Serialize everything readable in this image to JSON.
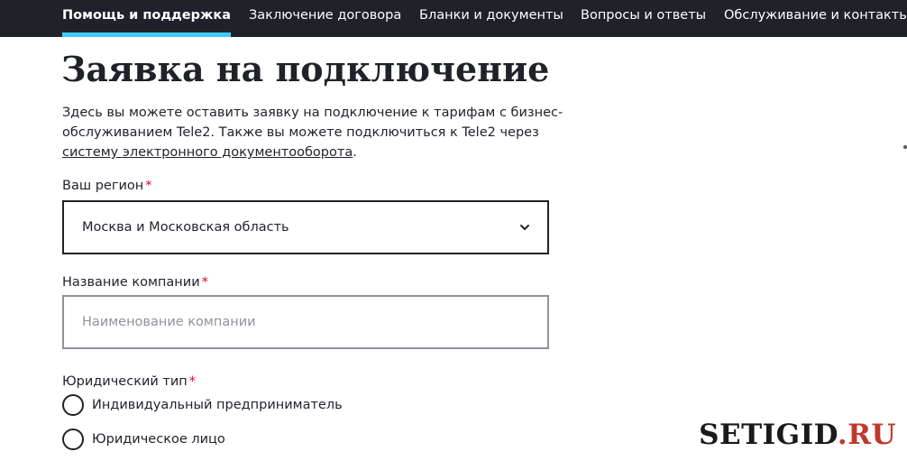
{
  "nav": {
    "items": [
      {
        "label": "Помощь и поддержка",
        "active": true
      },
      {
        "label": "Заключение договора",
        "active": false
      },
      {
        "label": "Бланки и документы",
        "active": false
      },
      {
        "label": "Вопросы и ответы",
        "active": false
      },
      {
        "label": "Обслуживание и контакты",
        "active": false
      }
    ]
  },
  "page": {
    "title": "Заявка на подключение",
    "intro_text": "Здесь вы можете оставить заявку на подключение к тарифам с бизнес-обслуживанием Tele2. Также вы можете подключиться к Tele2 через ",
    "intro_link": "систему электронного документооборота",
    "intro_end": "."
  },
  "form": {
    "required_mark": "*",
    "region": {
      "label": "Ваш регион",
      "value": "Москва и Московская область"
    },
    "company": {
      "label": "Название компании",
      "placeholder": "Наименование компании",
      "value": ""
    },
    "legal_type": {
      "label": "Юридический тип",
      "options": [
        "Индивидуальный предприниматель",
        "Юридическое лицо"
      ]
    }
  },
  "watermark": {
    "part1": "SETIGID",
    "part2": ".RU"
  },
  "colors": {
    "nav_bg": "#1f2229",
    "nav_active_underline": "#3fcbff",
    "required": "#e4002b",
    "input_border": "#8f9399"
  }
}
